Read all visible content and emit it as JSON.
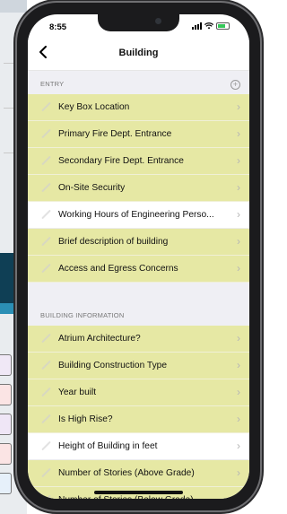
{
  "status_bar": {
    "time": "8:55"
  },
  "navbar": {
    "back_icon": "chevron-left-icon",
    "title": "Building"
  },
  "sections": [
    {
      "header": "ENTRY",
      "rows": [
        {
          "label": "Key Box Location",
          "filled": true
        },
        {
          "label": "Primary Fire Dept. Entrance",
          "filled": true
        },
        {
          "label": "Secondary Fire Dept. Entrance",
          "filled": true
        },
        {
          "label": "On-Site Security",
          "filled": true
        },
        {
          "label": "Working Hours of Engineering Perso...",
          "filled": false
        },
        {
          "label": "Brief description of building",
          "filled": true
        },
        {
          "label": "Access and Egress Concerns",
          "filled": true
        }
      ]
    },
    {
      "header": "BUILDING INFORMATION",
      "rows": [
        {
          "label": "Atrium Architecture?",
          "filled": true
        },
        {
          "label": "Building Construction Type",
          "filled": true
        },
        {
          "label": "Year built",
          "filled": true
        },
        {
          "label": "Is High Rise?",
          "filled": true
        },
        {
          "label": "Height of Building in feet",
          "filled": false
        },
        {
          "label": "Number of Stories (Above Grade)",
          "filled": true
        },
        {
          "label": "Number of Stories (Below Grade)",
          "filled": true
        }
      ]
    }
  ],
  "colors": {
    "highlight_row": "#e6e8a4",
    "section_bg": "#efeff4"
  }
}
